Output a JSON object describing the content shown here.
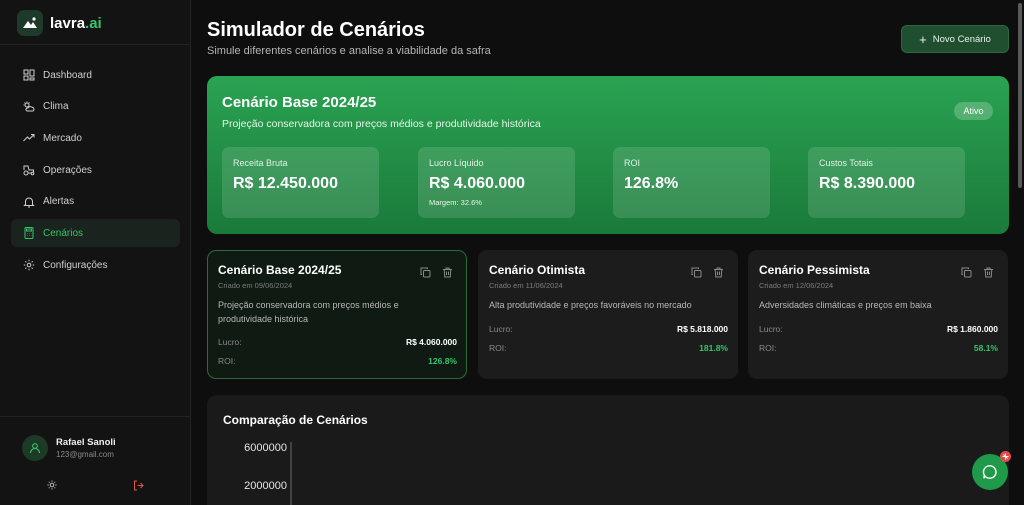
{
  "brand": {
    "name": "lavra",
    "suffix": ".ai"
  },
  "nav": [
    {
      "label": "Dashboard",
      "icon": "dashboard-icon",
      "active": false
    },
    {
      "label": "Clima",
      "icon": "sun-cloud-icon",
      "active": false
    },
    {
      "label": "Mercado",
      "icon": "trending-up-icon",
      "active": false
    },
    {
      "label": "Operações",
      "icon": "tractor-icon",
      "active": false
    },
    {
      "label": "Alertas",
      "icon": "bell-icon",
      "active": false
    },
    {
      "label": "Cenários",
      "icon": "calculator-icon",
      "active": true
    },
    {
      "label": "Configurações",
      "icon": "gear-icon",
      "active": false
    }
  ],
  "user": {
    "name": "Rafael Sanoli",
    "email": "123@gmail.com"
  },
  "header": {
    "title": "Simulador de Cenários",
    "subtitle": "Simule diferentes cenários e analise a viabilidade da safra",
    "new_button": "Novo Cenário",
    "new_button_icon": "+"
  },
  "hero": {
    "title": "Cenário Base 2024/25",
    "description": "Projeção conservadora com preços médios e produtividade histórica",
    "badge": "Ativo",
    "metrics": [
      {
        "label": "Receita Bruta",
        "value": "R$ 12.450.000",
        "extra": ""
      },
      {
        "label": "Lucro Líquido",
        "value": "R$ 4.060.000",
        "extra": "Margem: 32.6%"
      },
      {
        "label": "ROI",
        "value": "126.8%",
        "extra": ""
      },
      {
        "label": "Custos Totais",
        "value": "R$ 8.390.000",
        "extra": ""
      }
    ]
  },
  "scenarios": [
    {
      "title": "Cenário Base 2024/25",
      "date": "Criado em 09/06/2024",
      "description": "Projeção conservadora com preços médios e produtividade histórica",
      "profit_label": "Lucro:",
      "profit": "R$ 4.060.000",
      "roi_label": "ROI:",
      "roi": "126.8%",
      "selected": true
    },
    {
      "title": "Cenário Otimista",
      "date": "Criado em 11/06/2024",
      "description": "Alta produtividade e preços favoráveis no mercado",
      "profit_label": "Lucro:",
      "profit": "R$ 5.818.000",
      "roi_label": "ROI:",
      "roi": "181.8%",
      "selected": false
    },
    {
      "title": "Cenário Pessimista",
      "date": "Criado em 12/06/2024",
      "description": "Adversidades climáticas e preços em baixa",
      "profit_label": "Lucro:",
      "profit": "R$ 1.860.000",
      "roi_label": "ROI:",
      "roi": "58.1%",
      "selected": false
    }
  ],
  "comparison": {
    "title": "Comparação de Cenários",
    "chart_data": {
      "type": "bar",
      "title": "Comparação de Cenários",
      "yticks": [
        "6000000",
        "2000000"
      ]
    }
  },
  "colors": {
    "accent": "#35c46a",
    "hero_top": "#2aa352",
    "hero_bottom": "#1a7a3a",
    "background": "#0e0e0e",
    "card": "#1c1c1c"
  }
}
